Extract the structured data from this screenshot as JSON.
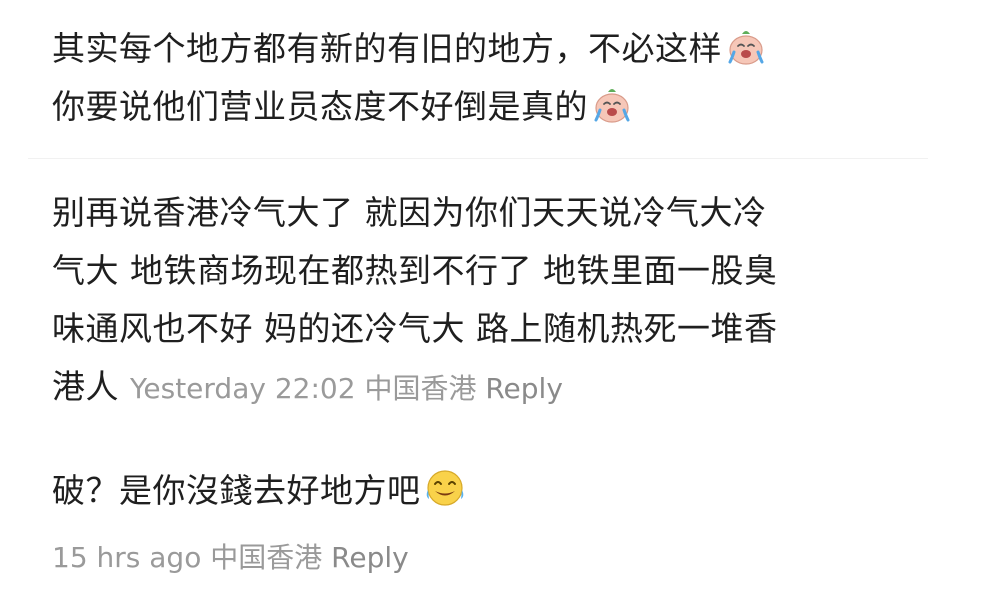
{
  "comments": [
    {
      "lines": [
        "其实每个地方都有新的有旧的地方，不必这样",
        "你要说他们营业员态度不好倒是真的"
      ],
      "emojis": [
        "crying-face-emoji",
        "crying-face-emoji"
      ]
    },
    {
      "lines": [
        "别再说香港冷气大了 就因为你们天天说冷气大冷",
        "气大 地铁商场现在都热到不行了 地铁里面一股臭",
        "味通风也不好 妈的还冷气大 路上随机热死一堆香",
        "港人"
      ],
      "time": "Yesterday 22:02",
      "location": "中国香港",
      "reply_label": "Reply"
    },
    {
      "lines": [
        "破？是你沒錢去好地方吧"
      ],
      "emoji": "tears-of-joy-emoji",
      "time": "15 hrs ago",
      "location": "中国香港",
      "reply_label": "Reply"
    }
  ]
}
